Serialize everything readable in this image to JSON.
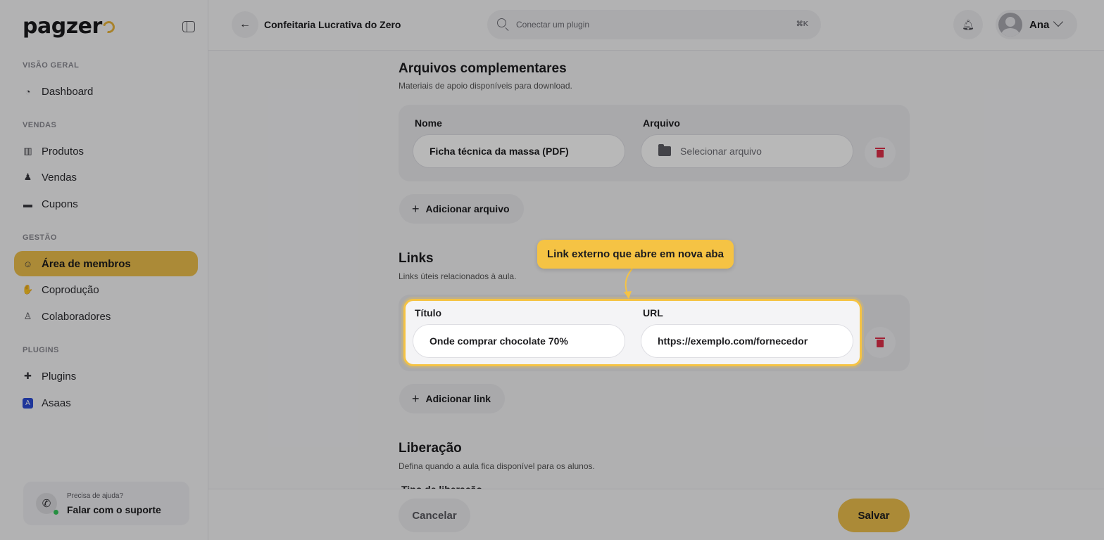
{
  "brand": {
    "logo_text": "pagzer"
  },
  "sidebar": {
    "sections": [
      {
        "label": "VISÃO GERAL",
        "items": [
          {
            "label": "Dashboard",
            "icon": "dashboard-icon"
          }
        ]
      },
      {
        "label": "VENDAS",
        "items": [
          {
            "label": "Produtos",
            "icon": "products-icon"
          },
          {
            "label": "Vendas",
            "icon": "sales-icon"
          },
          {
            "label": "Cupons",
            "icon": "coupon-icon"
          }
        ]
      },
      {
        "label": "GESTÃO",
        "items": [
          {
            "label": "Área de membros",
            "icon": "members-icon",
            "active": true
          },
          {
            "label": "Coprodução",
            "icon": "handshake-icon"
          },
          {
            "label": "Colaboradores",
            "icon": "user-icon"
          }
        ]
      },
      {
        "label": "PLUGINS",
        "items": [
          {
            "label": "Plugins",
            "icon": "puzzle-icon"
          },
          {
            "label": "Asaas",
            "icon": "asaas-icon"
          }
        ]
      }
    ],
    "support": {
      "line1": "Precisa de ajuda?",
      "line2": "Falar com o suporte"
    }
  },
  "topbar": {
    "course_title": "Confeitaria Lucrativa do Zero",
    "search_placeholder": "Conectar um plugin",
    "search_shortcut": "⌘K",
    "user_name": "Ana"
  },
  "attachments": {
    "title": "Arquivos complementares",
    "subtitle": "Materiais de apoio disponíveis para download.",
    "name_label": "Nome",
    "file_label": "Arquivo",
    "name_value": "Ficha técnica da massa (PDF)",
    "file_placeholder": "Selecionar arquivo",
    "add_label": "Adicionar arquivo"
  },
  "links": {
    "title": "Links",
    "subtitle": "Links úteis relacionados à aula.",
    "title_label": "Título",
    "url_label": "URL",
    "title_value": "Onde comprar chocolate 70%",
    "url_value": "https://exemplo.com/fornecedor",
    "add_label": "Adicionar link"
  },
  "release": {
    "title": "Liberação",
    "subtitle": "Defina quando a aula fica disponível para os alunos.",
    "type_label": "Tipo de liberação"
  },
  "tooltip": {
    "text": "Link externo que abre em nova aba"
  },
  "footer": {
    "cancel_label": "Cancelar",
    "save_label": "Salvar"
  },
  "colors": {
    "accent": "#edc04d",
    "highlight": "#f5c344",
    "danger": "#e0304a"
  }
}
